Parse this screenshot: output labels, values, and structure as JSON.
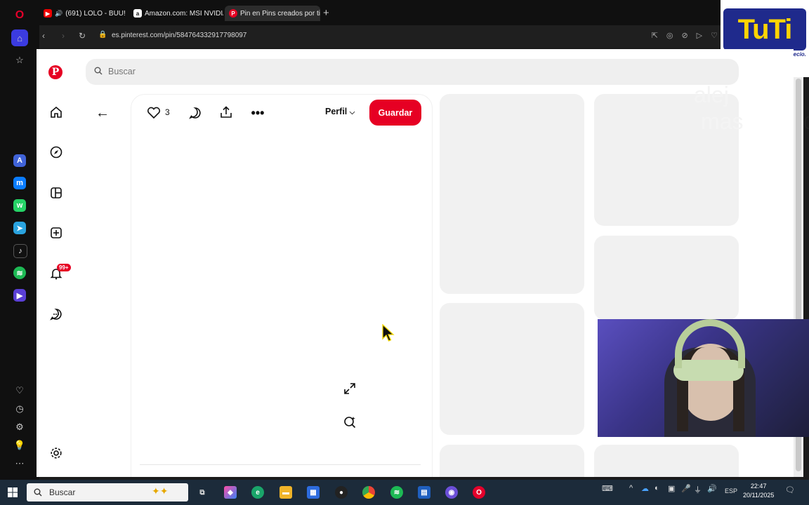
{
  "browser": {
    "tabs": [
      {
        "label": "(691) LOLO - BUU! (Vi",
        "favicon": "youtube-icon"
      },
      {
        "label": "Amazon.com: MSI NVIDIA",
        "favicon": "amazon-icon"
      },
      {
        "label": "Pin en Pins creados por ti",
        "favicon": "pinterest-icon",
        "active": true
      }
    ],
    "url": "es.pinterest.com/pin/584764332917798097"
  },
  "logo_overlay": {
    "brand": "TuTi",
    "slogan": "Alto en calidad, bajo en precio."
  },
  "pinterest": {
    "search_placeholder": "Buscar",
    "notifications_badge": "99+",
    "like_count": "3",
    "profile_label": "Perfil",
    "save_label": "Guardar"
  },
  "overlay_text": {
    "line1": "alej",
    "line2": "mas",
    "digit": "0"
  },
  "taskbar": {
    "search_placeholder": "Buscar",
    "language": "ESP",
    "time": "22:47",
    "date": "20/11/2025"
  },
  "colors": {
    "pinterest_red": "#e60023",
    "tuti_blue": "#1f2a8c",
    "tuti_yellow": "#ffd400"
  }
}
